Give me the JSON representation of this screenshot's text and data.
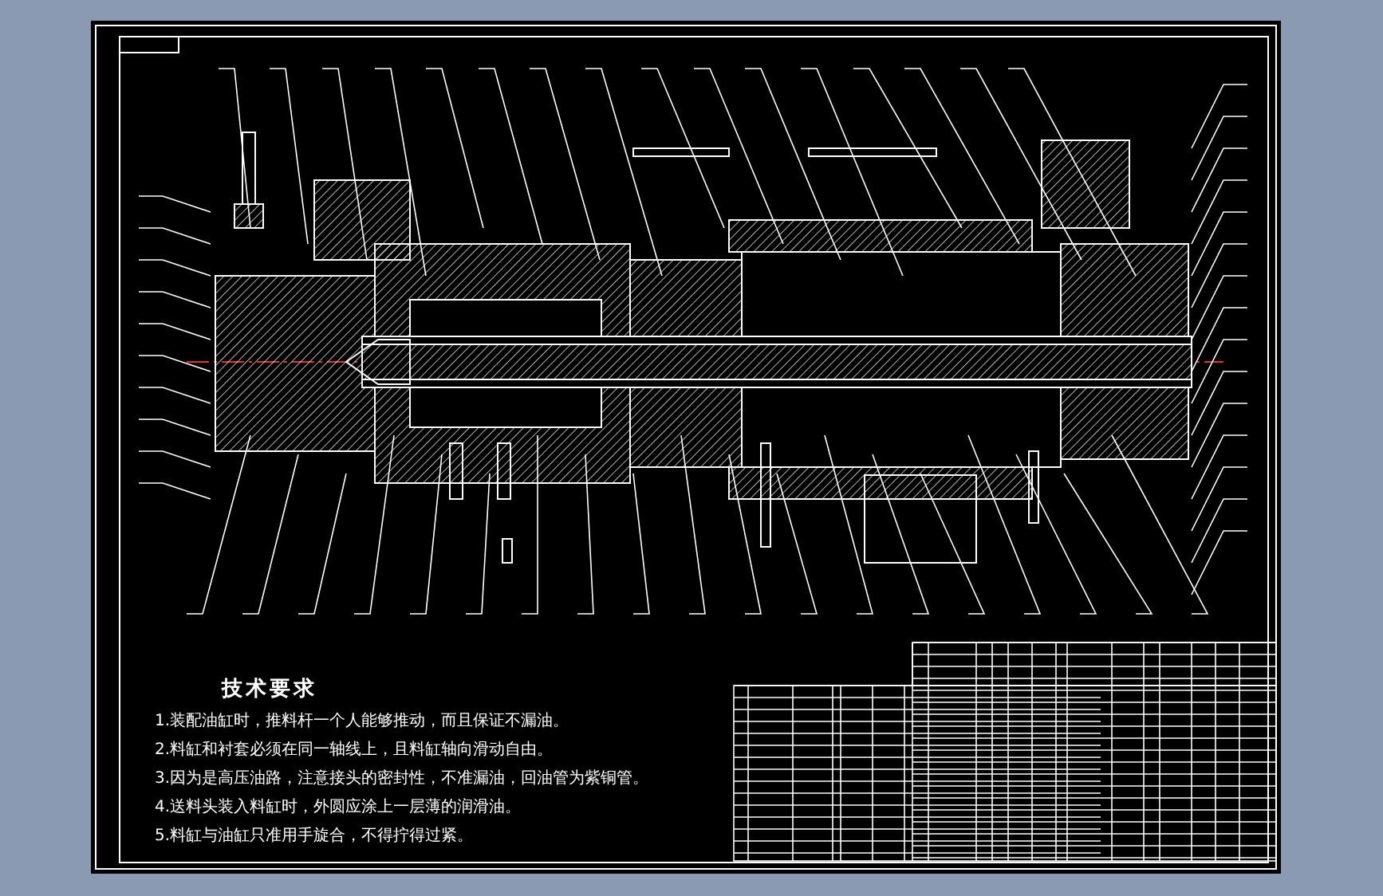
{
  "technical_requirements": {
    "title": "技术要求",
    "items": [
      "1.装配油缸时，推料杆一个人能够推动，而且保证不漏油。",
      "2.料缸和衬套必须在同一轴线上，且料缸轴向滑动自由。",
      "3.因为是高压油路，注意接头的密封性，不准漏油，回油管为紫铜管。",
      "4.送料头装入料缸时，外圆应涂上一层薄的润滑油。",
      "5.料缸与油缸只准用手旋合，不得拧得过紧。"
    ]
  }
}
